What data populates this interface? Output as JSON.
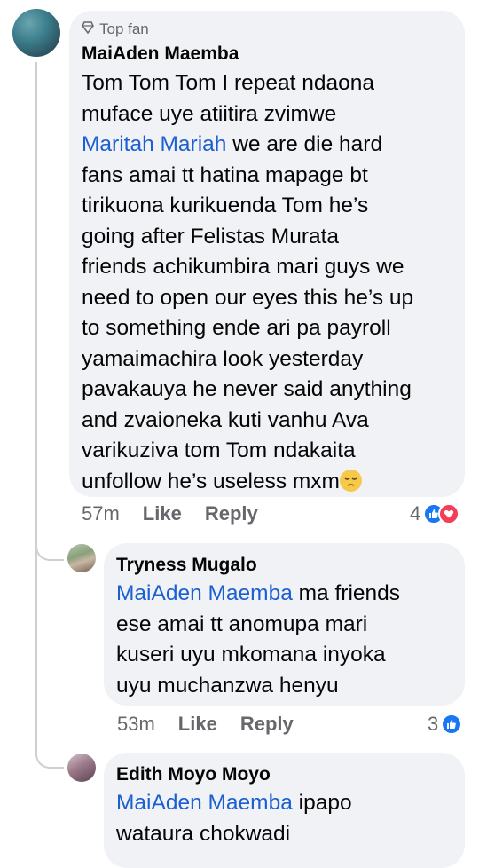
{
  "comment": {
    "badge": "Top fan",
    "author": "MaiAden Maemba",
    "lines": [
      {
        "text": "Tom Tom Tom I repeat ndaona"
      },
      {
        "text": "muface uye atiitira zvimwe"
      },
      {
        "mention": "Maritah Mariah",
        "text": " we are die hard"
      },
      {
        "text": "fans amai tt hatina mapage bt"
      },
      {
        "text": "tirikuona kurikuenda Tom he’s"
      },
      {
        "text": "going after Felistas Murata"
      },
      {
        "text": "friends achikumbira mari guys we"
      },
      {
        "text": "need to open our eyes this he’s up"
      },
      {
        "text": "to something ende ari pa payroll"
      },
      {
        "text": "yamaimachira look yesterday"
      },
      {
        "text": "pavakauya he never said anything"
      },
      {
        "text": "and zvaioneka kuti vanhu Ava"
      },
      {
        "text": "varikuziva tom Tom ndakaita"
      },
      {
        "text": "unfollow he’s useless mxm"
      }
    ],
    "time": "57m",
    "like_label": "Like",
    "reply_label": "Reply",
    "reaction_count": "4",
    "emoji": "pensive-face-emoji"
  },
  "replies": [
    {
      "author": "Tryness Mugalo",
      "lines": [
        {
          "mention": "MaiAden Maemba",
          "text": " ma friends"
        },
        {
          "text": "ese amai tt anomupa mari"
        },
        {
          "text": "kuseri uyu mkomana inyoka"
        },
        {
          "text": "uyu muchanzwa henyu"
        }
      ],
      "time": "53m",
      "like_label": "Like",
      "reply_label": "Reply",
      "reaction_count": "3"
    },
    {
      "author": "Edith Moyo Moyo",
      "lines": [
        {
          "mention": "MaiAden Maemba",
          "text": " ipapo"
        },
        {
          "text": "wataura chokwadi"
        }
      ]
    }
  ],
  "colors": {
    "mention": "#1b5fd1",
    "bubble": "#f0f2f5",
    "like": "#1877f2",
    "love": "#f33e58",
    "meta": "#65676b"
  }
}
